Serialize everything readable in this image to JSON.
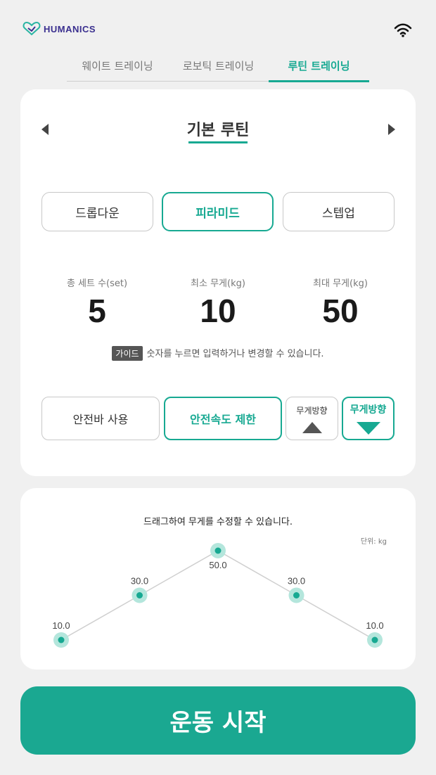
{
  "brand": {
    "name": "HUMANICS"
  },
  "tabs": [
    {
      "label": "웨이트 트레이닝",
      "active": false
    },
    {
      "label": "로보틱 트레이닝",
      "active": false
    },
    {
      "label": "루틴 트레이닝",
      "active": true
    }
  ],
  "routine": {
    "title": "기본 루틴"
  },
  "modes": [
    {
      "label": "드롭다운",
      "active": false
    },
    {
      "label": "피라미드",
      "active": true
    },
    {
      "label": "스텝업",
      "active": false
    }
  ],
  "stats": [
    {
      "label": "총 세트 수(set)",
      "value": "5"
    },
    {
      "label": "최소 무게(kg)",
      "value": "10"
    },
    {
      "label": "최대 무게(kg)",
      "value": "50"
    }
  ],
  "guide": {
    "badge": "가이드",
    "text": "숫자를 누르면 입력하거나 변경할 수 있습니다."
  },
  "options": {
    "safety_bar": "안전바 사용",
    "speed_limit": "안전속도 제한",
    "weight_dir_up": "무게방향",
    "weight_dir_down": "무게방향"
  },
  "chart_hint": "드래그하여 무게를 수정할 수 있습니다.",
  "unit_label": "단위: kg",
  "chart_data": {
    "type": "line",
    "x": [
      1,
      2,
      3,
      4,
      5
    ],
    "values": [
      10.0,
      30.0,
      50.0,
      30.0,
      10.0
    ],
    "point_labels": [
      "10.0",
      "30.0",
      "50.0",
      "30.0",
      "10.0"
    ],
    "ylim": [
      10,
      50
    ],
    "line_color": "#cfcfcf",
    "point_color": "#17a992",
    "halo_color": "#b4e6dc"
  },
  "start_button": "운동 시작",
  "colors": {
    "accent": "#17a992",
    "start": "#1aa891"
  }
}
